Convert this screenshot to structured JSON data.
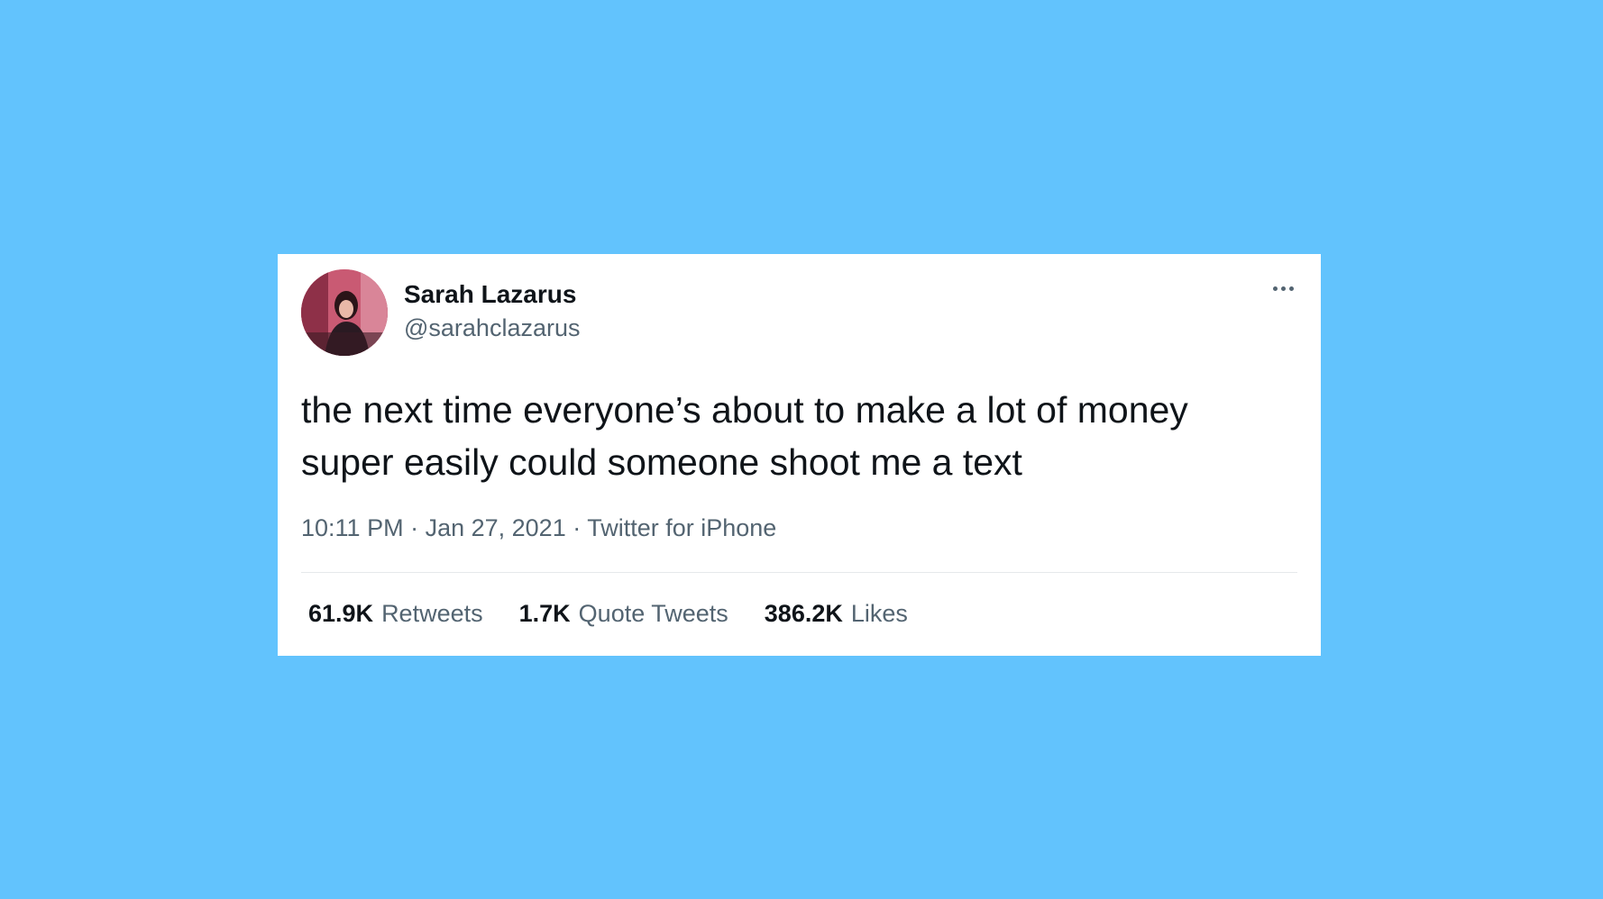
{
  "colors": {
    "background": "#62c3fd",
    "card": "#ffffff",
    "primary_text": "#0f1419",
    "secondary_text": "#536471"
  },
  "tweet": {
    "author": {
      "display_name": "Sarah Lazarus",
      "handle": "@sarahclazarus",
      "avatar_icon": "profile-photo"
    },
    "more_icon": "more-options-icon",
    "text": "the next time everyone’s about to make a lot of money\nsuper easily could someone shoot me a text",
    "time": "10:11 PM",
    "separator": " · ",
    "date": "Jan 27, 2021",
    "source": "Twitter for iPhone",
    "stats": {
      "retweets": {
        "count": "61.9K",
        "label": "Retweets"
      },
      "quote_tweets": {
        "count": "1.7K",
        "label": "Quote Tweets"
      },
      "likes": {
        "count": "386.2K",
        "label": "Likes"
      }
    }
  }
}
